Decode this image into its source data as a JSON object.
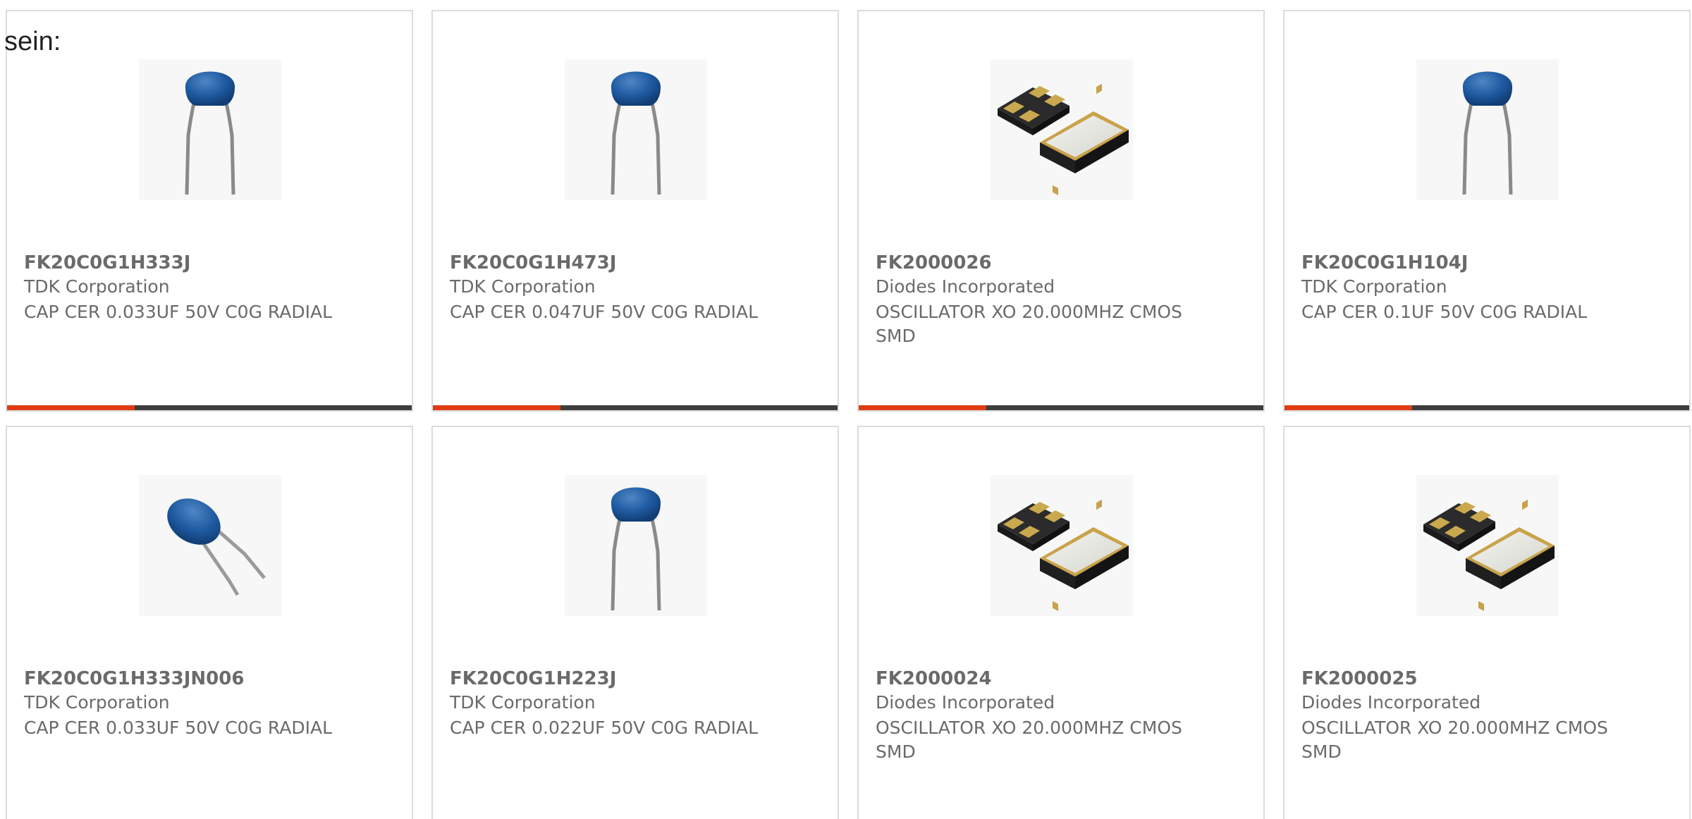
{
  "intro_text": "sein:",
  "colors": {
    "accent": "#e03c14",
    "bar_dark": "#3d3d3d",
    "text": "#6a6a6a",
    "border": "#dcdcdc"
  },
  "products": [
    {
      "part_number": "FK20C0G1H333J",
      "manufacturer": "TDK Corporation",
      "description": "CAP CER 0.033UF 50V C0G RADIAL",
      "image": "ceramic-capacitor-upright"
    },
    {
      "part_number": "FK20C0G1H473J",
      "manufacturer": "TDK Corporation",
      "description": "CAP CER 0.047UF 50V C0G RADIAL",
      "image": "ceramic-capacitor-upright"
    },
    {
      "part_number": "FK2000026",
      "manufacturer": "Diodes Incorporated",
      "description": "OSCILLATOR XO 20.000MHZ CMOS SMD",
      "image": "smd-oscillator"
    },
    {
      "part_number": "FK20C0G1H104J",
      "manufacturer": "TDK Corporation",
      "description": "CAP CER 0.1UF 50V C0G RADIAL",
      "image": "ceramic-capacitor-upright"
    },
    {
      "part_number": "FK20C0G1H333JN006",
      "manufacturer": "TDK Corporation",
      "description": "CAP CER 0.033UF 50V C0G RADIAL",
      "image": "ceramic-capacitor-tilted"
    },
    {
      "part_number": "FK20C0G1H223J",
      "manufacturer": "TDK Corporation",
      "description": "CAP CER 0.022UF 50V C0G RADIAL",
      "image": "ceramic-capacitor-upright"
    },
    {
      "part_number": "FK2000024",
      "manufacturer": "Diodes Incorporated",
      "description": "OSCILLATOR XO 20.000MHZ CMOS SMD",
      "image": "smd-oscillator"
    },
    {
      "part_number": "FK2000025",
      "manufacturer": "Diodes Incorporated",
      "description": "OSCILLATOR XO 20.000MHZ CMOS SMD",
      "image": "smd-oscillator"
    }
  ]
}
